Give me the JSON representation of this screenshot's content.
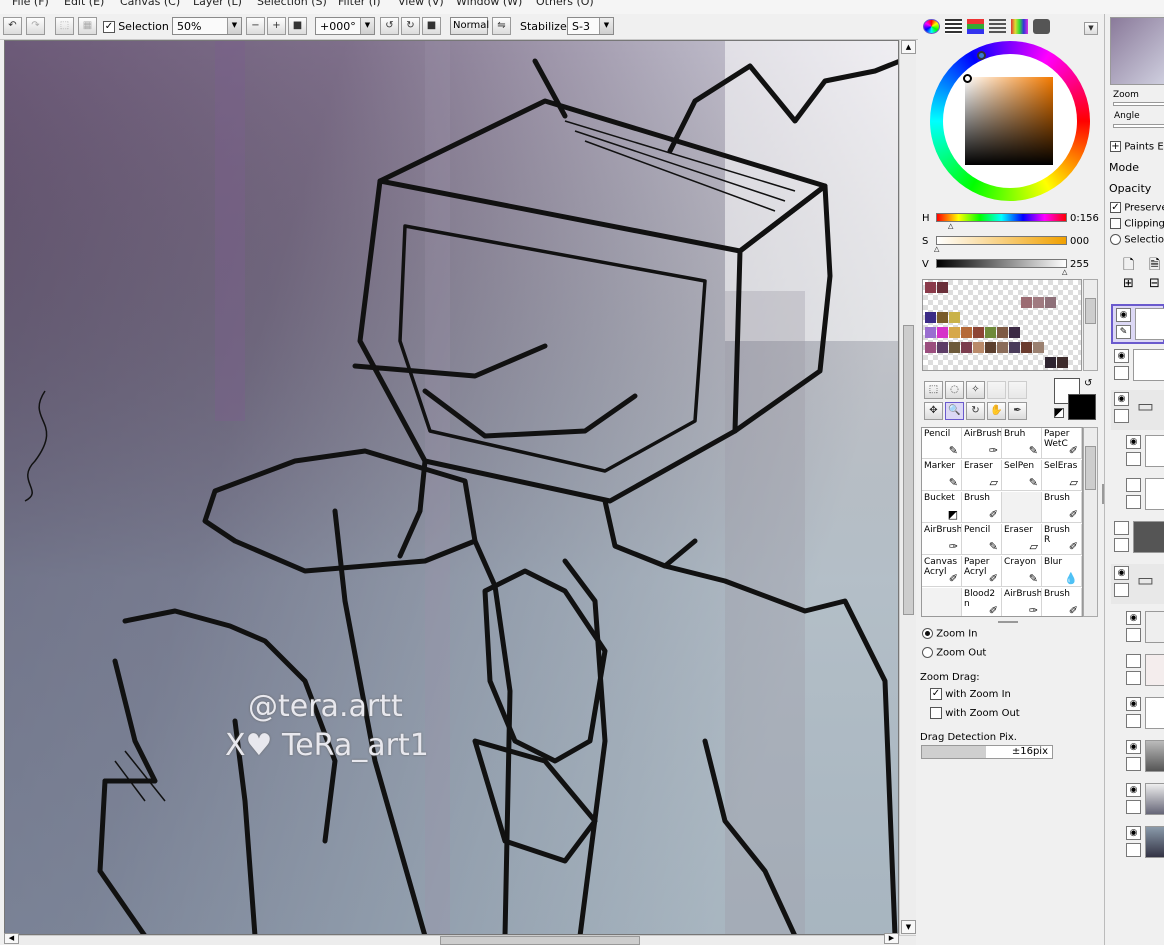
{
  "menu": [
    "File (F)",
    "Edit (E)",
    "Canvas (C)",
    "Layer (L)",
    "Selection (S)",
    "Filter (I)",
    "View (V)",
    "Window (W)",
    "Others (O)"
  ],
  "toolbar": {
    "selection_label": "Selection",
    "selection_checked": true,
    "zoom": "50%",
    "rotation": "+000°",
    "blend": "Normal",
    "stabilizer_label": "Stabilizer",
    "stabilizer": "S-3"
  },
  "canvas": {
    "watermark_instagram": "@tera.artt",
    "watermark_twitter": "X♥ TeRa_art1"
  },
  "hsv": {
    "h_label": "H",
    "h_value": "0:156",
    "s_label": "S",
    "s_value": "000",
    "v_label": "V",
    "v_value": "255"
  },
  "swatches": [
    "#8a3a4a",
    "#6a2f3a",
    "#9b6b72",
    "#a07a80",
    "#8e7079",
    "#3b2b86",
    "#7a5c2a",
    "#c9b24a",
    "#9a6ed0",
    "#d633c9",
    "#d6a84b",
    "#b56a38",
    "#8d4535",
    "#6f8a3a",
    "#7e5a44",
    "#3c2a44",
    "#9b4e7e",
    "#5e3d67",
    "#6d5a3a",
    "#7c3d4e",
    "#b98a6a",
    "#5b3f2e",
    "#8a6c5a",
    "#4a3b5a",
    "#6a3b2e",
    "#9a8070",
    "#2e2430",
    "#3e2c2c"
  ],
  "brushes": [
    {
      "name": "Pencil",
      "icon": "✎"
    },
    {
      "name": "AirBrush",
      "icon": "✑"
    },
    {
      "name": "Bruh",
      "icon": "✎"
    },
    {
      "name": "Paper WetC",
      "icon": "✐"
    },
    {
      "name": "Marker",
      "icon": "✎"
    },
    {
      "name": "Eraser",
      "icon": "▱"
    },
    {
      "name": "SelPen",
      "icon": "✎"
    },
    {
      "name": "SelEras",
      "icon": "▱"
    },
    {
      "name": "Bucket",
      "icon": "◩"
    },
    {
      "name": "Brush",
      "icon": "✐"
    },
    {
      "name": "",
      "icon": ""
    },
    {
      "name": "Brush",
      "icon": "✐"
    },
    {
      "name": "AirBrush",
      "icon": "✑"
    },
    {
      "name": "Pencil",
      "icon": "✎"
    },
    {
      "name": "Eraser",
      "icon": "▱"
    },
    {
      "name": "Brush R",
      "icon": "✐"
    },
    {
      "name": "Canvas Acryl",
      "icon": "✐"
    },
    {
      "name": "Paper Acryl",
      "icon": "✐"
    },
    {
      "name": "Crayon",
      "icon": "✎"
    },
    {
      "name": "Blur",
      "icon": "💧"
    },
    {
      "name": "",
      "icon": ""
    },
    {
      "name": "Blood2 n",
      "icon": "✐"
    },
    {
      "name": "AirBrush",
      "icon": "✑"
    },
    {
      "name": "Brush",
      "icon": "✐"
    }
  ],
  "zoom_opts": {
    "zoom_in": "Zoom In",
    "zoom_out": "Zoom Out",
    "drag_label": "Zoom Drag:",
    "with_zoom_in": "with Zoom In",
    "with_zoom_out": "with Zoom Out",
    "detect_label": "Drag Detection Pix.",
    "detect_value": "±16pix"
  },
  "layers": {
    "zoom_label": "Zoom",
    "angle_label": "Angle",
    "paints_label": "Paints E",
    "mode_label": "Mode",
    "opacity_label": "Opacity",
    "preserve_label": "Preserve",
    "clipping_label": "Clipping",
    "selection_label": "Selection"
  },
  "colors": {
    "accent": "#6a5acd",
    "fg": "#000000",
    "bg": "#ffffff"
  }
}
